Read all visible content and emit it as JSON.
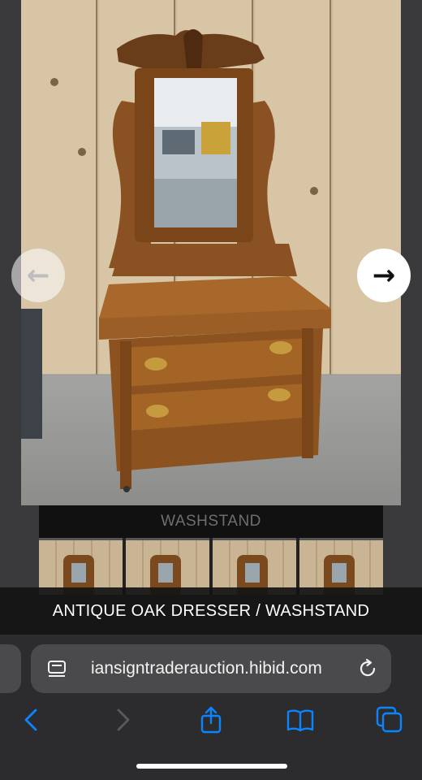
{
  "photo": {
    "alt_subject": "dresser-photo"
  },
  "carousel": {
    "prev_icon": "arrow-left-icon",
    "next_icon": "arrow-right-icon",
    "prev_glyph": "←",
    "next_glyph": "→"
  },
  "thumbnail_strip": {
    "title": "WASHSTAND",
    "count": 4
  },
  "caption": {
    "text": "ANTIQUE OAK DRESSER / WASHSTAND"
  },
  "browser": {
    "url": "iansigntraderauction.hibid.com",
    "icons": {
      "page_menu": "page-menu-icon",
      "reload": "reload-icon",
      "back": "back-chevron-icon",
      "forward": "forward-chevron-icon",
      "share": "share-icon",
      "bookmarks": "bookmarks-icon",
      "tabs": "tabs-icon"
    },
    "accent_color": "#0a84ff",
    "disabled_color": "#5a5a5e"
  }
}
